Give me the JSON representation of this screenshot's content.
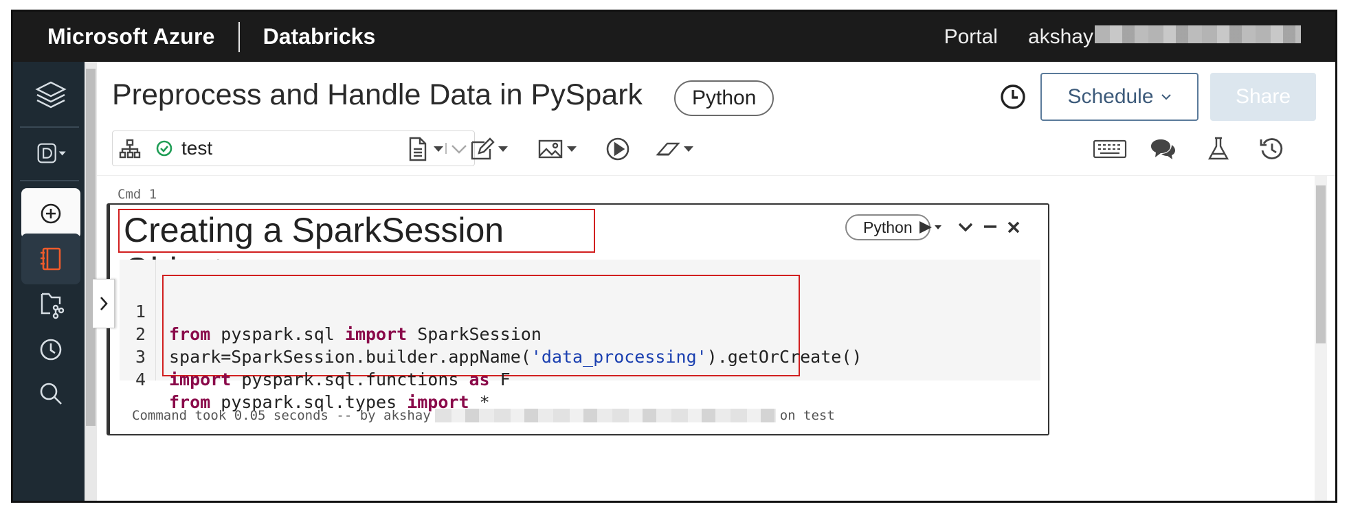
{
  "topbar": {
    "brand": "Microsoft Azure",
    "product": "Databricks",
    "portal": "Portal",
    "user": "akshay"
  },
  "notebook": {
    "title": "Preprocess and Handle Data in PySpark",
    "language": "Python",
    "schedule_label": "Schedule",
    "share_label": "Share"
  },
  "cluster": {
    "name": "test",
    "status": "running"
  },
  "cell": {
    "cmd_label": "Cmd 1",
    "heading": "Creating a SparkSession Object",
    "language": "Python",
    "lines": [
      {
        "n": "1"
      },
      {
        "n": "2"
      },
      {
        "n": "3"
      },
      {
        "n": "4"
      }
    ],
    "code": {
      "l1_kw1": "from",
      "l1_mod": " pyspark.sql ",
      "l1_kw2": "import",
      "l1_rest": " SparkSession",
      "l2_a": "spark=SparkSession.builder.appName(",
      "l2_str": "'data_processing'",
      "l2_b": ").getOrCreate()",
      "l3_kw1": "import",
      "l3_mod": " pyspark.sql.functions ",
      "l3_kw2": "as",
      "l3_rest": " F",
      "l4_kw1": "from",
      "l4_mod": " pyspark.sql.types ",
      "l4_kw2": "import",
      "l4_rest": " *"
    },
    "status_prefix": "Command took 0.05 seconds -- by akshay",
    "status_suffix": "on test"
  },
  "colors": {
    "topbar": "#1b1b1b",
    "sidebar": "#1e2a33",
    "highlight_box": "#d11f1f",
    "keyword": "#8a0a4a",
    "string": "#1a3fb0"
  }
}
